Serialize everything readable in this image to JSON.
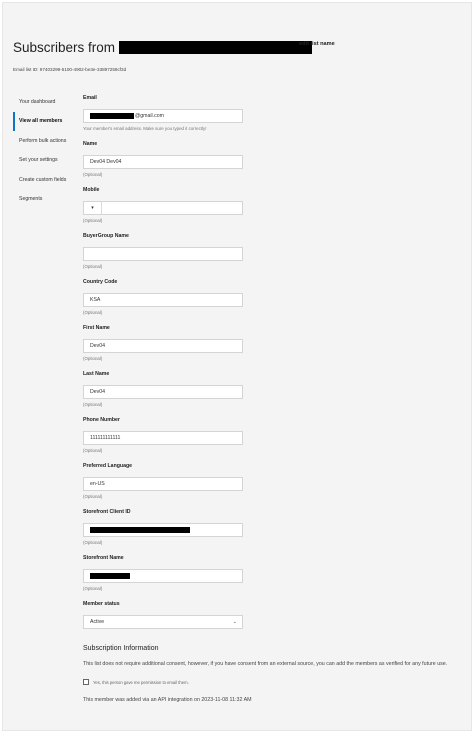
{
  "header": {
    "title_prefix": "Subscribers from",
    "edit_link": "edit list name",
    "list_id": "Email list ID: 97403299-5100-4902-be3e-33897259cf3d"
  },
  "sidebar": {
    "items": [
      {
        "label": "Your dashboard",
        "active": false
      },
      {
        "label": "View all members",
        "active": true
      },
      {
        "label": "Perform bulk actions",
        "active": false
      },
      {
        "label": "Set your settings",
        "active": false
      },
      {
        "label": "Create custom fields",
        "active": false
      },
      {
        "label": "Segments",
        "active": false
      }
    ]
  },
  "form": {
    "email": {
      "label": "Email",
      "value_suffix": "@gmail.com",
      "hint": "Your member's email address. Make sure you typed it correctly!"
    },
    "name": {
      "label": "Name",
      "value": "Dev04 Dev04",
      "hint": "(Optional)"
    },
    "mobile": {
      "label": "Mobile",
      "flag": "▾",
      "value": "",
      "hint": "(Optional)"
    },
    "buyer_group": {
      "label": "BuyerGroup Name",
      "value": "",
      "hint": "(Optional)"
    },
    "country_code": {
      "label": "Country Code",
      "value": "KSA",
      "hint": "(Optional)"
    },
    "first_name": {
      "label": "First Name",
      "value": "Dev04",
      "hint": "(Optional)"
    },
    "last_name": {
      "label": "Last Name",
      "value": "Dev04",
      "hint": "(Optional)"
    },
    "phone_number": {
      "label": "Phone Number",
      "value": "111111111111",
      "hint": "(Optional)"
    },
    "preferred_language": {
      "label": "Preferred Language",
      "value": "en-US",
      "hint": "(Optional)"
    },
    "storefront_client_id": {
      "label": "Storefront Client ID",
      "hint": "(Optional)"
    },
    "storefront_name": {
      "label": "Storefront Name",
      "hint": "(Optional)"
    },
    "member_status": {
      "label": "Member status",
      "value": "Active"
    }
  },
  "subscription": {
    "title": "Subscription Information",
    "description": "This list does not require additional consent, however, if you have consent from an external source, you can add the members as verified for any future use.",
    "consent_label": "Yes, this person gave me permission to email them.",
    "consent_checked": false,
    "added_note": "This member was added via an API integration on 2023-11-08 11:32 AM"
  }
}
